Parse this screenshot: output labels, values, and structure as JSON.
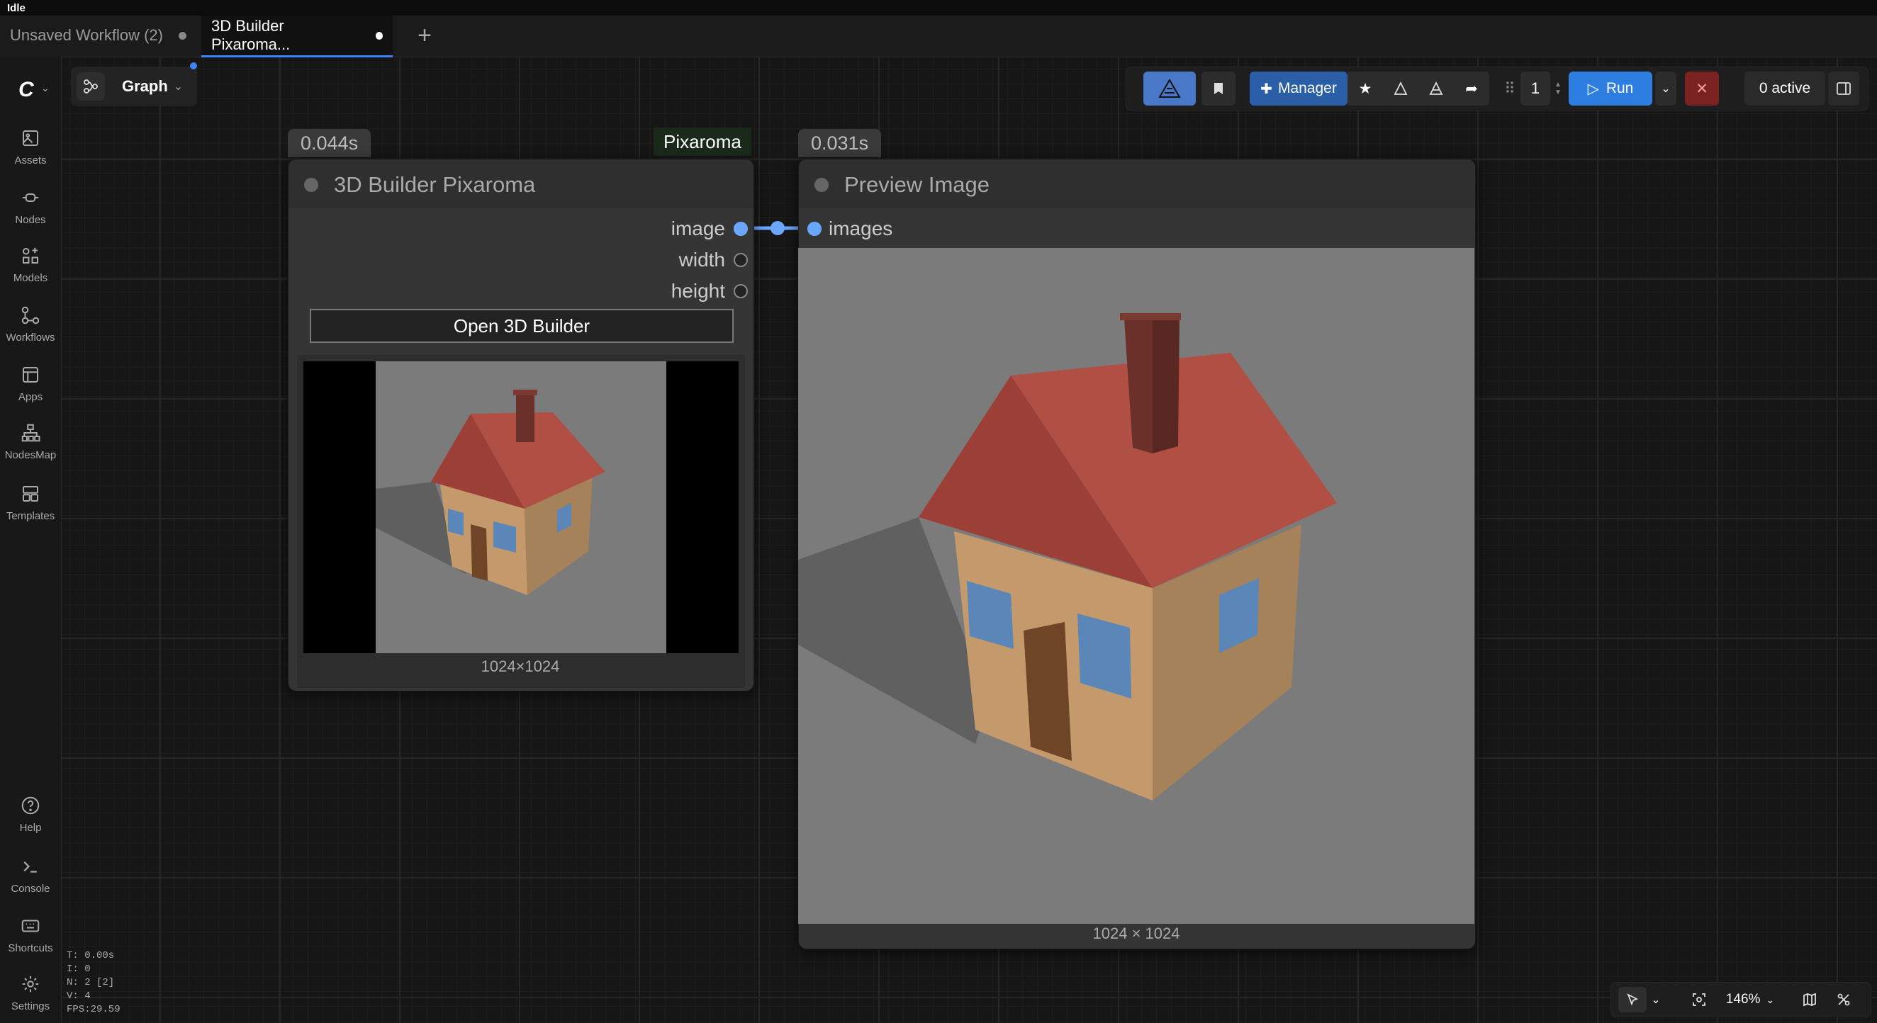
{
  "status": "Idle",
  "tabs": [
    {
      "label": "Unsaved Workflow (2)",
      "active": false
    },
    {
      "label": "3D Builder Pixaroma...",
      "active": true
    }
  ],
  "sidebar": {
    "items": [
      {
        "label": "Assets",
        "icon": "image-icon"
      },
      {
        "label": "Nodes",
        "icon": "plug-icon"
      },
      {
        "label": "Models",
        "icon": "shapes-icon"
      },
      {
        "label": "Workflows",
        "icon": "workflow-icon"
      },
      {
        "label": "Apps",
        "icon": "layout-icon"
      },
      {
        "label": "NodesMap",
        "icon": "sitemap-icon"
      },
      {
        "label": "Templates",
        "icon": "templates-icon"
      }
    ],
    "bottom_items": [
      {
        "label": "Help",
        "icon": "help-icon"
      },
      {
        "label": "Console",
        "icon": "terminal-icon"
      },
      {
        "label": "Shortcuts",
        "icon": "keyboard-icon"
      },
      {
        "label": "Settings",
        "icon": "gear-icon"
      }
    ]
  },
  "graph_menu": {
    "label": "Graph"
  },
  "toolbar": {
    "manager_label": "Manager",
    "batch_count": "1",
    "run_label": "Run",
    "active_label": "0 active"
  },
  "nodes": {
    "builder": {
      "time": "0.044s",
      "title": "3D Builder Pixaroma",
      "outputs": [
        "image",
        "width",
        "height"
      ],
      "button_label": "Open 3D Builder",
      "image_size": "1024×1024"
    },
    "group_label": "Pixaroma",
    "preview": {
      "time": "0.031s",
      "title": "Preview Image",
      "input": "images",
      "image_size": "1024 × 1024"
    }
  },
  "stats": {
    "t": "T: 0.00s",
    "i": "I: 0",
    "n": "N: 2 [2]",
    "v": "V: 4",
    "fps": "FPS:29.59"
  },
  "zoom": "146%",
  "colors": {
    "accent": "#3b82f6",
    "run": "#2e7de0",
    "manager": "#2a5fa8",
    "link": "#6ba7ff",
    "roof": "#a84a40",
    "wall": "#c49a6c",
    "window": "#5a86b8"
  }
}
